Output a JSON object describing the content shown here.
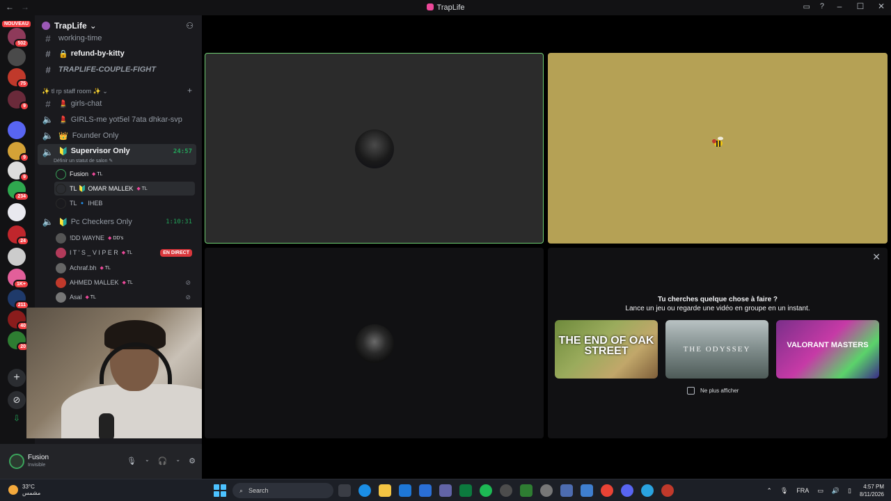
{
  "window": {
    "title": "TrapLife",
    "nav_back": "←",
    "nav_forward": "→",
    "inbox_icon": "inbox-icon",
    "help_icon": "help-icon",
    "minimize": "–",
    "maximize": "☐",
    "close": "✕"
  },
  "servers": {
    "nouveau_badge": "NOUVEAU",
    "items": [
      {
        "name": "server-1",
        "badge": "502",
        "color": "#8e3a5a"
      },
      {
        "name": "server-2",
        "badge": "",
        "color": "#4a4a4a"
      },
      {
        "name": "server-3",
        "badge": "75",
        "color": "#c0392b"
      },
      {
        "name": "server-4",
        "badge": "9",
        "color": "#6a2a3a"
      },
      {
        "name": "server-5",
        "badge": "",
        "color": "#5865f2"
      },
      {
        "name": "server-6",
        "badge": "9",
        "color": "#d4a237"
      },
      {
        "name": "server-7",
        "badge": "9",
        "color": "#dddddd"
      },
      {
        "name": "server-8",
        "badge": "234",
        "color": "#2fa84f"
      },
      {
        "name": "server-9",
        "badge": "",
        "color": "#e9e9ef"
      },
      {
        "name": "server-10",
        "badge": "24",
        "color": "#c0262c"
      },
      {
        "name": "server-11",
        "badge": "",
        "color": "#cccccc"
      },
      {
        "name": "server-12",
        "badge": "1K+",
        "color": "#e25f9a"
      },
      {
        "name": "server-13",
        "badge": "211",
        "color": "#1f3a6a"
      },
      {
        "name": "server-14",
        "badge": "40",
        "color": "#8a1c1c"
      },
      {
        "name": "server-15",
        "badge": "20",
        "color": "#2e7d32"
      }
    ],
    "add_icon": "+",
    "explore_icon": "⊘",
    "download_icon": "⇩"
  },
  "guild": {
    "name": "TrapLife",
    "chevron": "⌄",
    "invite_icon": "add-member-icon"
  },
  "channels": {
    "working_time": "working-time",
    "refund": "refund-by-kitty",
    "couple_fight": "TRAPLIFE-COUPLE-FIGHT",
    "category": "✨ tl rp staff room ✨",
    "girls_chat": "girls-chat",
    "girls_me": "GIRLS-me yot5el 7ata dhkar-svp",
    "founder_only": "Founder Only",
    "supervisor_only": "Supervisor Only",
    "supervisor_timer": "24:57",
    "supervisor_status": "Définir un statut de salon",
    "pc_checkers": "Pc Checkers Only",
    "pc_timer": "1:10:31"
  },
  "voice_users_supervisor": [
    {
      "name": "Fusion",
      "tag": "TL",
      "color": "#3ba55c"
    },
    {
      "name": "TL 🔰 OMAR MALLEK",
      "tag": "TL",
      "color": "#1e1e1e"
    },
    {
      "name": "TL 🔹 IHEB",
      "tag": "",
      "color": "#2a2a2a"
    }
  ],
  "voice_users_pc": [
    {
      "name": "!DD WAYNE",
      "tag": "DD's",
      "live": false,
      "muted": false
    },
    {
      "name": "I T ' S _ V I P E R",
      "tag": "TL",
      "live": true,
      "muted": false
    },
    {
      "name": "Achraf.bh",
      "tag": "TL",
      "live": false,
      "muted": false
    },
    {
      "name": "AHMED MALLEK",
      "tag": "TL",
      "live": false,
      "muted": true
    },
    {
      "name": "Asal",
      "tag": "TL",
      "live": false,
      "muted": true
    }
  ],
  "live_label": "EN DIRECT",
  "user_panel": {
    "name": "Fusion",
    "status": "Invisible"
  },
  "activity": {
    "line1": "Tu cherches quelque chose à faire ?",
    "line2": "Lance un jeu ou regarde une vidéo en groupe en un instant.",
    "cards": [
      {
        "title": "THE END OF OAK STREET"
      },
      {
        "title": "THE ODYSSEY"
      },
      {
        "title": "VALORANT MASTERS"
      }
    ],
    "checkbox_label": "Ne plus afficher"
  },
  "taskbar": {
    "temp": "33°C",
    "weather_desc": "مشمس",
    "search_placeholder": "Search",
    "lang": "FRA",
    "time": "4:57 PM",
    "date": "8/11/2026"
  },
  "colors": {
    "accent_green": "#23a55a",
    "live_red": "#da373c",
    "tag_pink": "#ec4899"
  }
}
